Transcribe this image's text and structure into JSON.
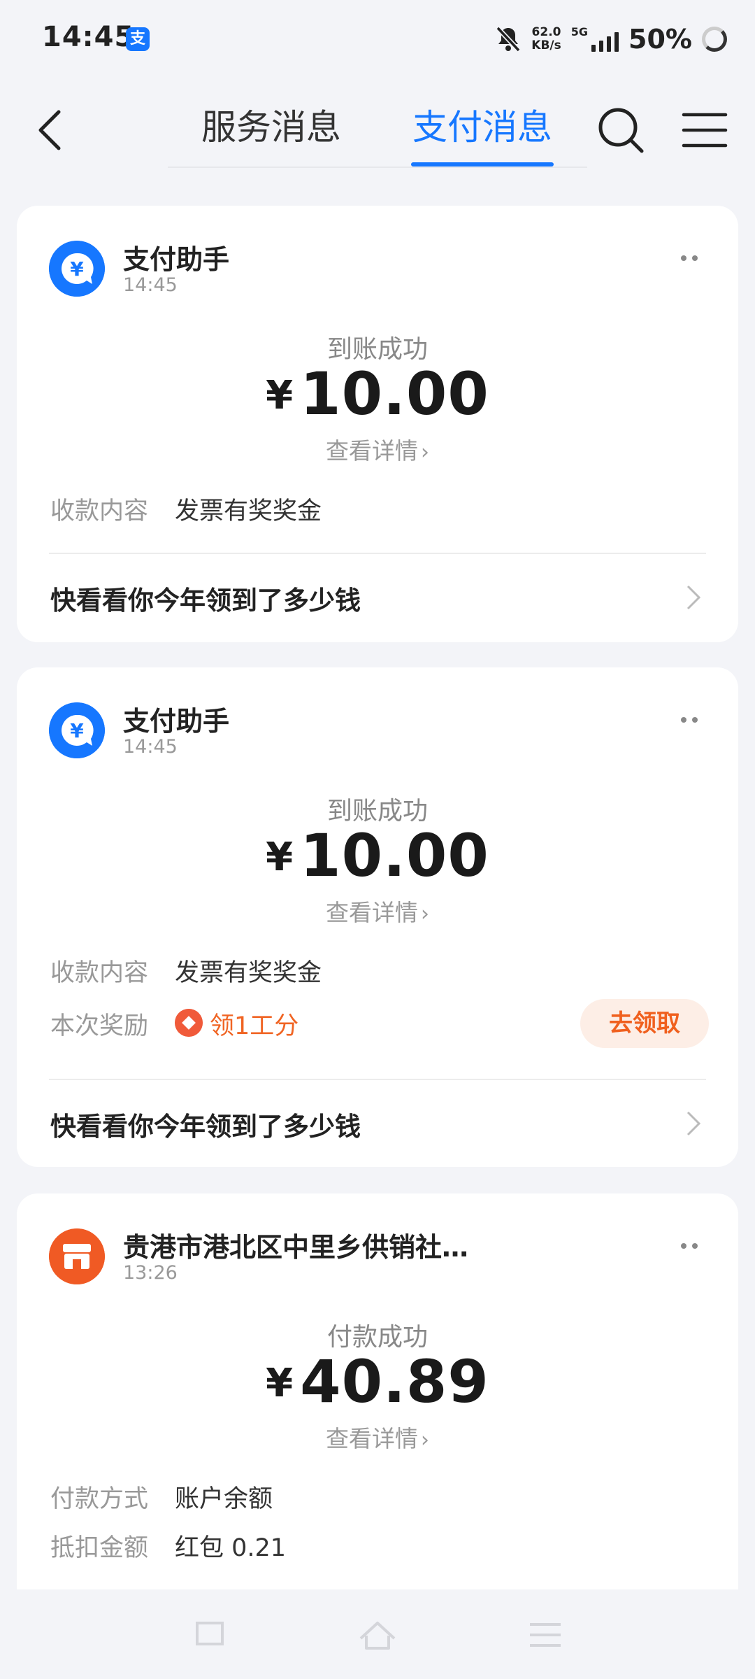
{
  "status_bar": {
    "time": "14:45",
    "app_icon_glyph": "支",
    "net_speed_value": "62.0",
    "net_speed_unit": "KB/s",
    "network": "5G",
    "battery": "50%"
  },
  "nav": {
    "tabs": [
      {
        "label": "服务消息",
        "active": false
      },
      {
        "label": "支付消息",
        "active": true
      }
    ],
    "accent_color": "#1677ff"
  },
  "cards": [
    {
      "sender": "支付助手",
      "time": "14:45",
      "status": "到账成功",
      "currency": "¥",
      "amount": "10.00",
      "detail_link": "查看详情",
      "rows": [
        {
          "label": "收款内容",
          "value": "发票有奖奖金"
        }
      ],
      "promo": "快看看你今年领到了多少钱"
    },
    {
      "sender": "支付助手",
      "time": "14:45",
      "status": "到账成功",
      "currency": "¥",
      "amount": "10.00",
      "detail_link": "查看详情",
      "rows": [
        {
          "label": "收款内容",
          "value": "发票有奖奖金"
        }
      ],
      "reward": {
        "label": "本次奖励",
        "value": "领1工分",
        "button": "去领取"
      },
      "promo": "快看看你今年领到了多少钱"
    },
    {
      "sender": "贵港市港北区中里乡供销社…",
      "time": "13:26",
      "status": "付款成功",
      "currency": "¥",
      "amount": "40.89",
      "detail_link": "查看详情",
      "rows": [
        {
          "label": "付款方式",
          "value": "账户余额"
        },
        {
          "label": "抵扣金额",
          "value": "红包 0.21"
        }
      ]
    }
  ]
}
